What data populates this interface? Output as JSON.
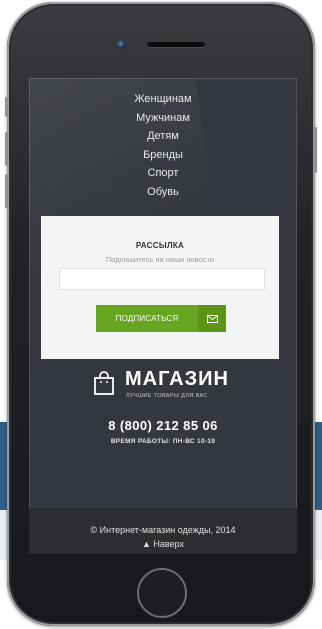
{
  "nav": {
    "items": [
      "Женщинам",
      "Мужчинам",
      "Детям",
      "Бренды",
      "Спорт",
      "Обувь"
    ]
  },
  "subscribe": {
    "title": "РАССЫЛКА",
    "subtitle": "Подпишитесь на наши новости",
    "email_value": "",
    "button_label": "ПОДПИСАТЬСЯ",
    "button_icon": "mail-icon",
    "button_color": "#66a51f"
  },
  "brand": {
    "name": "МАГАЗИН",
    "tagline": "ЛУЧШИЕ ТОВАРЫ ДЛЯ ВАС",
    "icon": "shopping-bag-icon"
  },
  "contact": {
    "phone": "8 (800) 212 85 06",
    "hours": "ВРЕМЯ РАБОТЫ: ПН-ВС 10-19"
  },
  "footer": {
    "copyright": "© Интернет-магазин одежды, 2014",
    "back_to_top": "▲ Наверх"
  },
  "colors": {
    "screen_bg": "#34373d",
    "accent_green": "#66a51f",
    "page_band_blue": "#2d5f86"
  }
}
